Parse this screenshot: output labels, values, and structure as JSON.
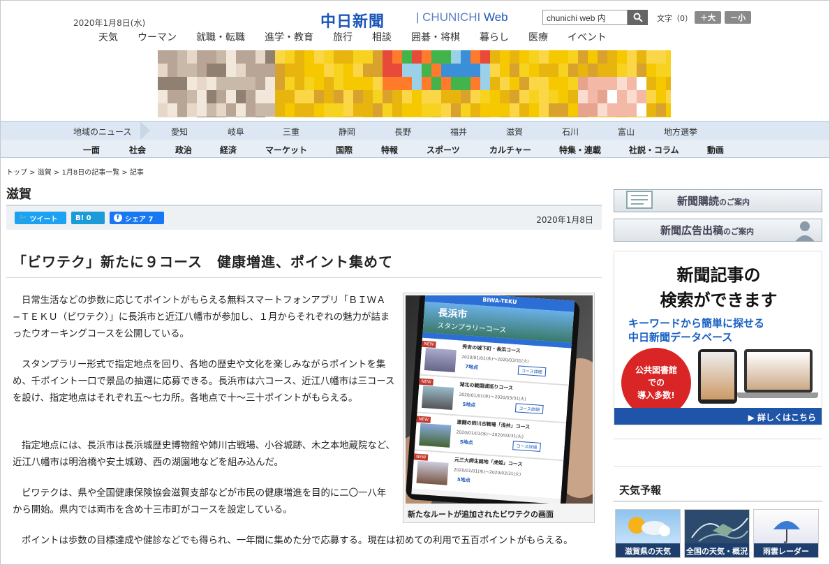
{
  "header": {
    "date": "2020年1月8日(水)",
    "logo": "中日新聞",
    "logo_sub": "CHUNICHI",
    "logo_web": "Web",
    "search_value": "chunichi web 内",
    "font_size_label": "文字（0）",
    "font_plus": "＋大",
    "font_minus": "－小"
  },
  "top_nav": [
    "天気",
    "ウーマン",
    "就職・転職",
    "進学・教育",
    "旅行",
    "相談",
    "囲碁・将棋",
    "暮らし",
    "医療",
    "イベント"
  ],
  "region_nav": {
    "label": "地域のニュース",
    "items": [
      "愛知",
      "岐阜",
      "三重",
      "静岡",
      "長野",
      "福井",
      "滋賀",
      "石川",
      "富山",
      "地方選挙"
    ]
  },
  "category_nav": [
    "一面",
    "社会",
    "政治",
    "経済",
    "マーケット",
    "国際",
    "特報",
    "スポーツ",
    "カルチャー",
    "特集・連載",
    "社説・コラム",
    "動画"
  ],
  "breadcrumb": "トップ > 滋賀 > 1月8日の記事一覧 > 記事",
  "section_title": "滋賀",
  "share": {
    "tweet": "ツイート",
    "hatena": "B! 0",
    "facebook": "シェア 7"
  },
  "article": {
    "date": "2020年1月8日",
    "headline": "「ビワテク」新たに９コース　健康増進、ポイント集めて",
    "paragraphs": [
      "日常生活などの歩数に応じてポイントがもらえる無料スマートフォンアプリ「ＢＩＷＡ−ＴＥＫＵ（ビワテク）」に長浜市と近江八幡市が参加し、１月からそれぞれの魅力が詰まったウオーキングコースを公開している。",
      "スタンプラリー形式で指定地点を回り、各地の歴史や文化を楽しみながらポイントを集め、千ポイント一口で景品の抽選に応募できる。長浜市は六コース、近江八幡市は三コースを設け、指定地点はそれぞれ五〜七カ所。各地点で十〜三十ポイントがもらえる。",
      "指定地点には、長浜市は長浜城歴史博物館や姉川古戦場、小谷城跡、木之本地蔵院など、近江八幡市は明治橋や安土城跡、西の湖園地などを組み込んだ。",
      "ビワテクは、県や全国健康保険協会滋賀支部などが市民の健康増進を目的に二〇一八年から開始。県内では両市を含め十三市町がコースを設定している。",
      "ポイントは歩数の目標達成や健診などでも得られ、一年間に集めた分で応募する。現在は初めての利用で五百ポイントがもらえる。"
    ],
    "photo_caption": "新たなルートが追加されたビワテクの画面",
    "app": {
      "header": "BIWA-TEKU",
      "city": "長浜市",
      "banner": "スタンプラリーコース",
      "courses": [
        {
          "name": "秀吉の城下町・長浜コース",
          "period": "2020/01/01(水)～2020/03/31(火)",
          "points": "7地点",
          "btn": "コース詳細"
        },
        {
          "name": "湖北の戦国城巡りコース",
          "period": "2020/01/01(水)～2020/03/31(火)",
          "points": "5地点",
          "btn": "コース詳細"
        },
        {
          "name": "激闘の姉川古戦場「浅井」コース",
          "period": "2020/01/01(水)～2020/03/31(火)",
          "points": "5地点",
          "btn": "コース詳細"
        },
        {
          "name": "元三大師生誕地「虎姫」コース",
          "period": "2020/01/01(水)～2020/03/31(火)",
          "points": "5地点",
          "btn": ""
        }
      ],
      "badge": "NEW"
    }
  },
  "sidebar": {
    "subscribe": {
      "main": "新聞購読",
      "sub": "のご案内"
    },
    "advertise": {
      "main": "新聞広告出稿",
      "sub": "のご案内"
    },
    "db_ad": {
      "line1": "新聞記事の",
      "line2": "検索ができます",
      "line3": "キーワードから簡単に探せる",
      "line4": "中日新聞データベース",
      "circle1": "公共図書館",
      "circle2": "での",
      "circle3": "導入多数!",
      "footer": "▶ 詳しくはこちら"
    },
    "weather": {
      "title": "天気予報",
      "tiles": [
        "滋賀県の天気",
        "全国の天気・概況",
        "雨雲レーダー"
      ]
    }
  }
}
